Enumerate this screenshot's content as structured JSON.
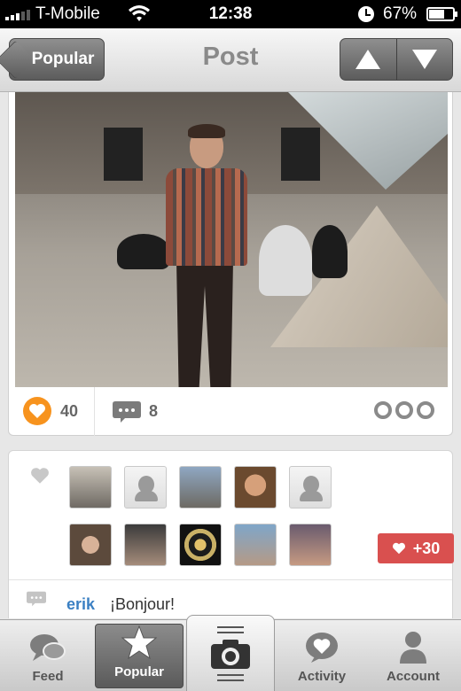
{
  "status_bar": {
    "carrier": "T-Mobile",
    "time": "12:38",
    "battery": "67%",
    "battery_level": 0.67
  },
  "nav": {
    "back_label": "Popular",
    "title": "Post"
  },
  "post": {
    "likes_count": "40",
    "comments_count": "8"
  },
  "likers": {
    "extra_count": "+30"
  },
  "comment": {
    "user": "erik",
    "text": "¡Bonjour!"
  },
  "tabs": [
    {
      "label": "Feed",
      "icon": "speech-bubbles-icon"
    },
    {
      "label": "Popular",
      "icon": "star-icon"
    },
    {
      "label": "",
      "icon": "camera-icon"
    },
    {
      "label": "Activity",
      "icon": "heart-bubble-icon"
    },
    {
      "label": "Account",
      "icon": "person-icon"
    }
  ],
  "colors": {
    "accent_orange": "#f7931e",
    "like_badge_red": "#d9504f",
    "username_blue": "#3b80c3"
  }
}
